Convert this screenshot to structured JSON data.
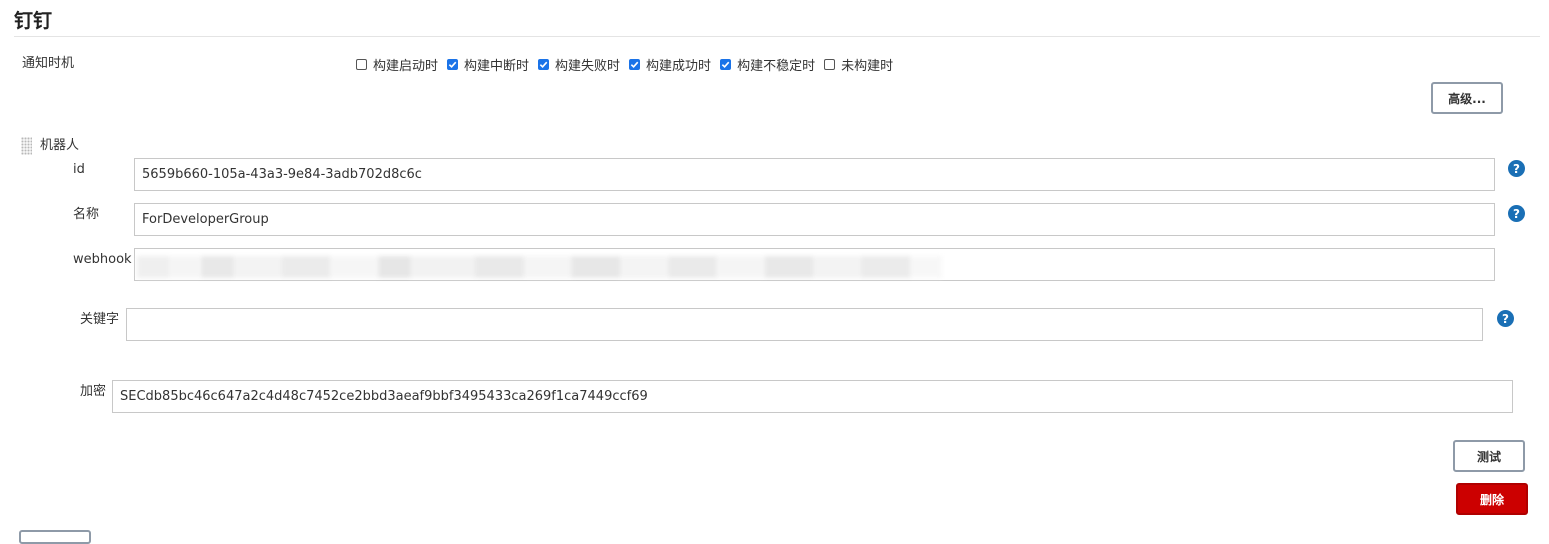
{
  "section": {
    "title": "钉钉"
  },
  "notify": {
    "label": "通知时机",
    "options": [
      {
        "label": "构建启动时",
        "checked": false
      },
      {
        "label": "构建中断时",
        "checked": true
      },
      {
        "label": "构建失败时",
        "checked": true
      },
      {
        "label": "构建成功时",
        "checked": true
      },
      {
        "label": "构建不稳定时",
        "checked": true
      },
      {
        "label": "未构建时",
        "checked": false
      }
    ],
    "advanced_label": "高级..."
  },
  "robot": {
    "label": "机器人",
    "id_label": "id",
    "id_value": "5659b660-105a-43a3-9e84-3adb702d8c6c",
    "name_label": "名称",
    "name_value": "ForDeveloperGroup",
    "webhook_label": "webhook",
    "webhook_value": "",
    "keyword_label": "关键字",
    "keyword_value": "",
    "secret_label": "加密",
    "secret_value": "SECdb85bc46c647a2c4d48c7452ce2bbd3aeaf9bbf3495433ca269f1ca7449ccf69",
    "test_label": "测试",
    "delete_label": "删除"
  },
  "help_icon_glyph": "?",
  "colors": {
    "accent": "#1a73e8",
    "help": "#1a6fb5",
    "danger": "#cc0000"
  }
}
